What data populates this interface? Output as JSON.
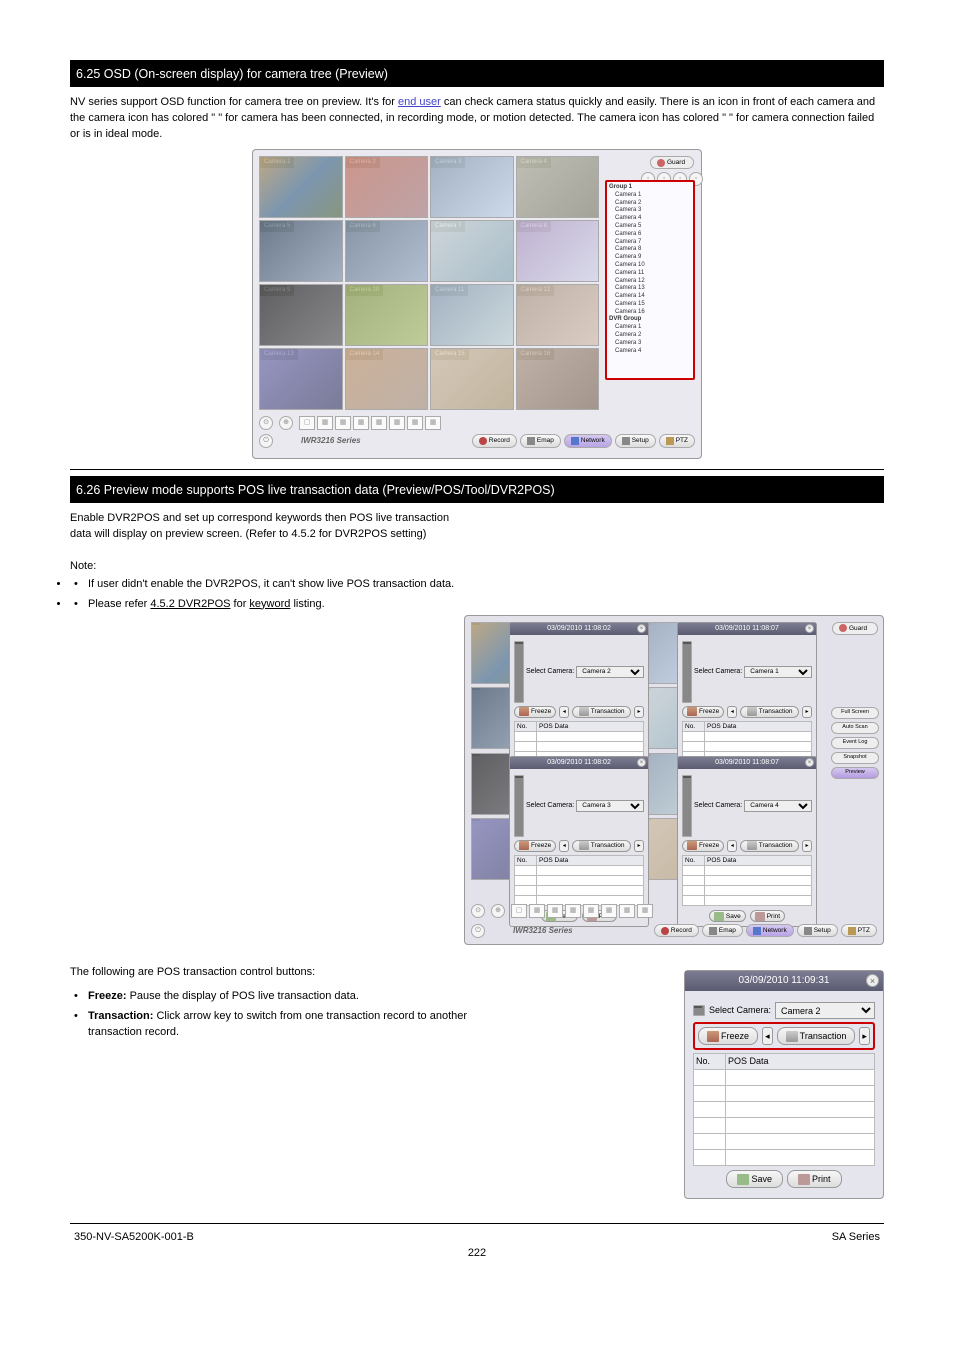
{
  "header_bar": "6.25 OSD (On-screen display) for camera tree (Preview)",
  "intro_before_link": "NV series support OSD function for camera tree on preview. It's for ",
  "intro_link": "end user",
  "intro_bridge": " can check camera status quickly and easily. There is an icon in front of each camera and the camera icon has colored ",
  "intro_quote1": "\"  \"",
  "intro_after_q1": " for camera has been connected, in recording mode, or motion detected. The camera icon has colored ",
  "intro_quote2": "\"  \"",
  "intro_after_q2": " for camera connection failed or is in ideal mode.",
  "screenshot1": {
    "brand": "IWR3216 Series",
    "nav": [
      "Record",
      "Emap",
      "Network",
      "Setup",
      "PTZ"
    ],
    "layout_title": "layout buttons",
    "guard": "Guard",
    "cameras": [
      "Camera 1",
      "Camera 2",
      "Camera 3",
      "Camera 4",
      "Camera 5",
      "Camera 6",
      "Camera 7",
      "Camera 8",
      "Camera 9",
      "Camera 10",
      "Camera 11",
      "Camera 12",
      "Camera 13",
      "Camera 14",
      "Camera 15",
      "Camera 16"
    ],
    "tree_group1": "Group 1",
    "tree_group2": "DVR Group",
    "tree_items1": [
      "Camera 1",
      "Camera 2",
      "Camera 3",
      "Camera 4",
      "Camera 5",
      "Camera 6",
      "Camera 7",
      "Camera 8",
      "Camera 9",
      "Camera 10",
      "Camera 11",
      "Camera 12",
      "Camera 13",
      "Camera 14",
      "Camera 15",
      "Camera 16"
    ],
    "tree_items2": [
      "Camera 1",
      "Camera 2",
      "Camera 3",
      "Camera 4"
    ]
  },
  "sec2_bar": "6.26 Preview mode supports POS live transaction data (Preview/POS/Tool/DVR2POS)",
  "sec2_p1": "Enable DVR2POS and set up correspond keywords then POS live transaction data will display on preview screen. (Refer to 4.5.2 for DVR2POS setting)",
  "sec2_li1_a": "If user didn't enable the",
  "sec2_li1_b": "DVR2POS, it can't show live POS transaction data.",
  "sec2_li2_a": "Please refer ",
  "sec2_li2_b": "4.5.2 DVR2POS",
  "sec2_li2_c": " for ",
  "sec2_li2_d": "keyword",
  "sec2_li2_e": " listing.",
  "screenshot2": {
    "brand": "IWR3216 Series",
    "rside": [
      "Full Screen",
      "Auto Scan",
      "Event Log",
      "Snapshot",
      "Preview"
    ],
    "nav": [
      "Record",
      "Emap",
      "Network",
      "Setup",
      "PTZ"
    ],
    "guard": "Guard",
    "pos_times": [
      "03/09/2010 11:08:02",
      "03/09/2010 11:08:07",
      "03/09/2010 11:08:02",
      "03/09/2010 11:08:07"
    ],
    "pos_cams": [
      "Camera 2",
      "Camera 1",
      "Camera 3",
      "Camera 4"
    ],
    "pos_label": "Select Camera:",
    "freeze": "Freeze",
    "trans": "Transaction",
    "th_no": "No.",
    "th_data": "POS Data",
    "save": "Save",
    "print": "Print"
  },
  "sec3_p1": "The following are POS transaction control buttons:",
  "sec3_freeze_l": "Freeze:",
  "sec3_freeze_t": " Pause the display of POS live transaction data.",
  "sec3_trans_l": "Transaction:",
  "sec3_trans_t": " Click arrow key to switch from one transaction record to another transaction record.",
  "poslarge": {
    "time": "03/09/2010 11:09:31",
    "label": "Select Camera:",
    "camera": "Camera 2",
    "freeze": "Freeze",
    "trans": "Transaction",
    "no": "No.",
    "data": "POS Data",
    "save": "Save",
    "print": "Print"
  },
  "footer_left": "350-NV-SA5200K-001-B",
  "footer_right": "SA Series",
  "footer_page": "222"
}
